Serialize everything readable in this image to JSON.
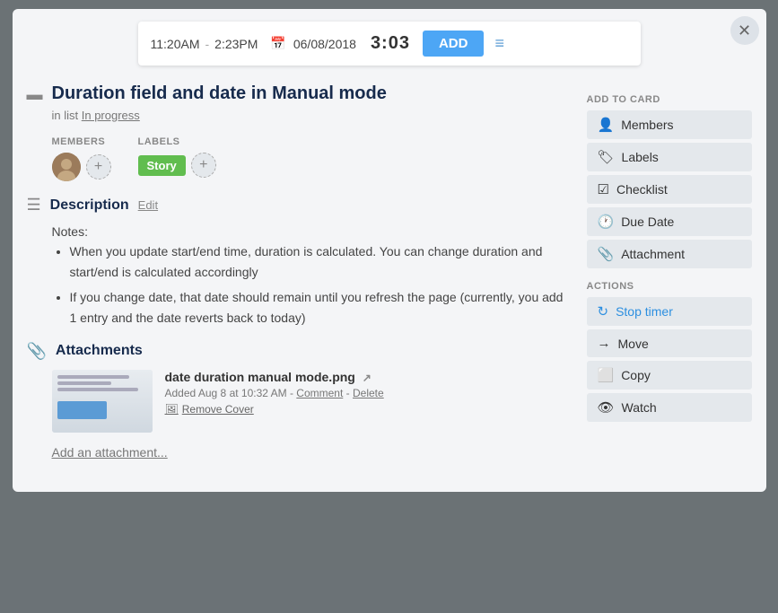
{
  "modal": {
    "close_label": "✕"
  },
  "timer": {
    "start_time": "11:20AM",
    "dash": "-",
    "end_time": "2:23PM",
    "date": "06/08/2018",
    "duration": "3:03",
    "add_label": "ADD"
  },
  "card": {
    "title": "Duration field and date in Manual mode",
    "list_prefix": "in list",
    "list_name": "In progress"
  },
  "members_section": {
    "label": "MEMBERS"
  },
  "labels_section": {
    "label": "LABELS",
    "tag": "Story"
  },
  "description": {
    "section_title": "Description",
    "edit_label": "Edit",
    "notes_label": "Notes:",
    "bullet1": "When you update start/end time, duration is calculated. You can change duration and start/end is calculated accordingly",
    "bullet2": "If you change date, that date should remain until you refresh the page (currently, you add 1 entry and the date reverts back to today)"
  },
  "attachments": {
    "section_title": "Attachments",
    "file_name": "date duration manual mode.png",
    "added_text": "Added Aug 8 at 10:32 AM",
    "comment_link": "Comment",
    "delete_link": "Delete",
    "remove_cover": "Remove Cover",
    "add_link": "Add an attachment..."
  },
  "sidebar": {
    "add_to_card_label": "ADD TO CARD",
    "members_btn": "Members",
    "labels_btn": "Labels",
    "checklist_btn": "Checklist",
    "due_date_btn": "Due Date",
    "attachment_btn": "Attachment",
    "actions_label": "ACTIONS",
    "stop_timer_btn": "Stop timer",
    "move_btn": "Move",
    "copy_btn": "Copy",
    "watch_btn": "Watch"
  }
}
